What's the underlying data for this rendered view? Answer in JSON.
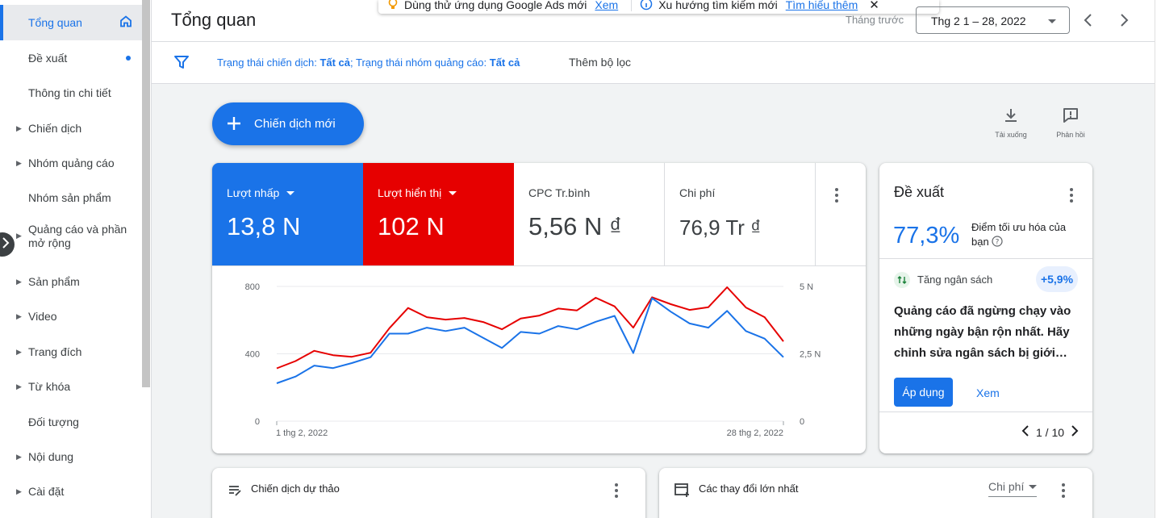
{
  "sidebar": {
    "items": [
      {
        "label": "Tổng quan"
      },
      {
        "label": "Đề xuất"
      },
      {
        "label": "Thông tin chi tiết"
      },
      {
        "label": "Chiến dịch"
      },
      {
        "label": "Nhóm quảng cáo"
      },
      {
        "label": "Nhóm sản phẩm"
      },
      {
        "label": "Quảng cáo và phần mở rộng"
      },
      {
        "label": "Sản phẩm"
      },
      {
        "label": "Video"
      },
      {
        "label": "Trang đích"
      },
      {
        "label": "Từ khóa"
      },
      {
        "label": "Đối tượng"
      },
      {
        "label": "Nội dung"
      },
      {
        "label": "Cài đặt"
      }
    ]
  },
  "header": {
    "title": "Tổng quan",
    "period_label": "Tháng trước",
    "date_range": "Thg 2 1 – 28, 2022"
  },
  "notification": {
    "text1": "Dùng thử ứng dụng Google Ads mới",
    "link1": "Xem",
    "text2": "Xu hướng tìm kiếm mới",
    "link2": "Tìm hiểu thêm"
  },
  "filter": {
    "campaign_status_label": "Trạng thái chiến dịch:",
    "campaign_status_value": "Tất cả",
    "adgroup_status_label": "; Trạng thái nhóm quảng cáo:",
    "adgroup_status_value": "Tất cả",
    "add_filter": "Thêm bộ lọc"
  },
  "actions": {
    "new_campaign": "Chiến dịch mới",
    "download": "Tải xuống",
    "feedback": "Phản hồi"
  },
  "metrics": [
    {
      "label": "Lượt nhấp",
      "value": "13,8 N",
      "color": "#1a73e8"
    },
    {
      "label": "Lượt hiển thị",
      "value": "102 N",
      "color": "#e60000"
    },
    {
      "label": "CPC Tr.bình",
      "value": "5,56 N ₫"
    },
    {
      "label": "Chi phí",
      "value": "76,9 Tr ₫"
    }
  ],
  "chart_data": {
    "type": "line",
    "x": [
      "1 thg 2, 2022",
      "2 thg 2, 2022",
      "3 thg 2, 2022",
      "4 thg 2, 2022",
      "5 thg 2, 2022",
      "6 thg 2, 2022",
      "7 thg 2, 2022",
      "8 thg 2, 2022",
      "9 thg 2, 2022",
      "10 thg 2, 2022",
      "11 thg 2, 2022",
      "12 thg 2, 2022",
      "13 thg 2, 2022",
      "14 thg 2, 2022",
      "15 thg 2, 2022",
      "16 thg 2, 2022",
      "17 thg 2, 2022",
      "18 thg 2, 2022",
      "19 thg 2, 2022",
      "20 thg 2, 2022",
      "21 thg 2, 2022",
      "22 thg 2, 2022",
      "23 thg 2, 2022",
      "24 thg 2, 2022",
      "25 thg 2, 2022",
      "26 thg 2, 2022",
      "27 thg 2, 2022",
      "28 thg 2, 2022"
    ],
    "x_tick_labels": [
      "1 thg 2, 2022",
      "28 thg 2, 2022"
    ],
    "left_axis": {
      "ticks": [
        "0",
        "400",
        "800"
      ],
      "range": [
        0,
        800
      ]
    },
    "right_axis": {
      "ticks": [
        "0",
        "2,5 N",
        "5 N"
      ],
      "range": [
        0,
        5000
      ]
    },
    "series": [
      {
        "name": "Lượt nhấp",
        "axis": "left",
        "color": "#1a73e8",
        "values": [
          225,
          265,
          330,
          315,
          345,
          380,
          520,
          520,
          555,
          535,
          555,
          495,
          435,
          530,
          520,
          565,
          545,
          590,
          625,
          405,
          730,
          650,
          580,
          555,
          655,
          535,
          490,
          380
        ]
      },
      {
        "name": "Lượt hiển thị",
        "axis": "right",
        "color": "#e60000",
        "values": [
          1960,
          2230,
          2610,
          2450,
          2390,
          2540,
          3450,
          4200,
          3860,
          3770,
          3830,
          3680,
          3410,
          3810,
          3920,
          4180,
          4110,
          4580,
          4260,
          3470,
          4600,
          4340,
          4130,
          4230,
          4970,
          4220,
          3860,
          2960
        ]
      }
    ],
    "grid": true
  },
  "recommendation": {
    "title": "Đề xuất",
    "score": "77,3%",
    "score_label": "Điểm tối ưu hóa của bạn",
    "category": "Tăng ngân sách",
    "uplift": "+5,9%",
    "body": "Quảng cáo đã ngừng chạy vào những ngày bận rộn nhất. Hãy chỉnh sửa ngân sách bị giới…",
    "apply": "Áp dụng",
    "view": "Xem",
    "page": "1 / 10"
  },
  "bottom_cards": {
    "drafts_title": "Chiến dịch dự thảo",
    "changes_title": "Các thay đổi lớn nhất",
    "sort_label": "Chi phí"
  }
}
